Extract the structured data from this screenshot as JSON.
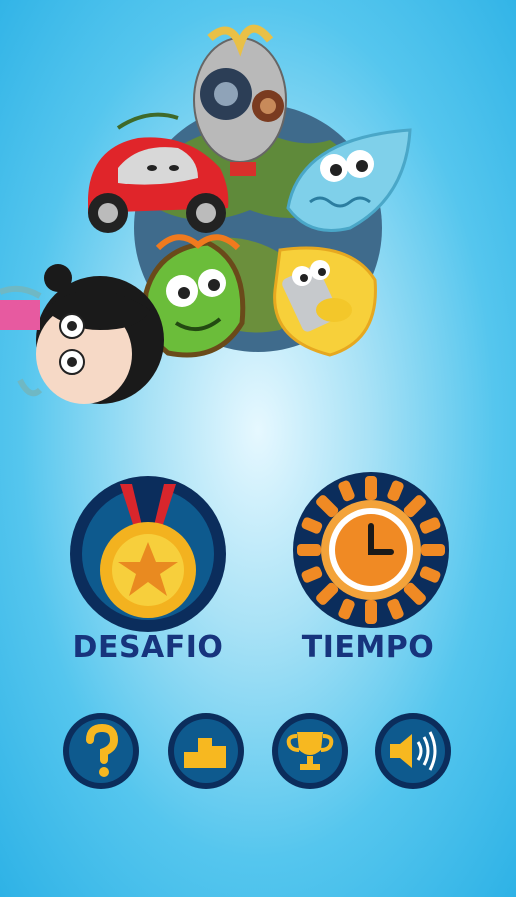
{
  "menu": {
    "challenge_label": "DESAFIO",
    "time_label": "TIEMPO"
  },
  "icons": {
    "challenge": "medal-star-icon",
    "time": "clock-sun-icon",
    "help": "question-icon",
    "ranking": "podium-icon",
    "achievements": "trophy-icon",
    "sound": "speaker-icon"
  },
  "colors": {
    "label": "#17347d",
    "button_dark": "#0a2a5a",
    "accent_yellow": "#f7b820",
    "accent_orange": "#f08a24"
  }
}
